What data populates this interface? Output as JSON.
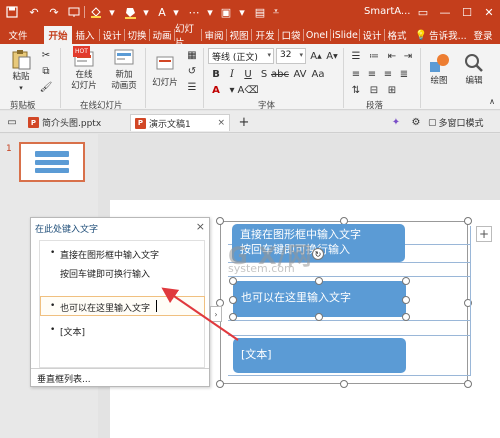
{
  "app": {
    "title": "SmartA...",
    "user_button": "登录",
    "help_search": "告诉我..."
  },
  "ribbon_tabs": [
    "文件",
    "开始",
    "插入",
    "设计",
    "切换",
    "动画",
    "幻灯片",
    "审阅",
    "视图",
    "开发",
    "口袋",
    "OneI",
    "iSlide",
    "设计",
    "格式"
  ],
  "ribbon": {
    "paste": "粘贴",
    "online_slides": "在线\n幻灯片",
    "new_slide": "新加\n动画页",
    "slides_btn": "幻灯片",
    "font_name": "等线 (正文)",
    "font_size": "32",
    "drawing": "绘图",
    "editing": "编辑",
    "group_labels": {
      "clipboard": "剪贴板",
      "online_slides": "在线幻灯片",
      "font": "字体",
      "paragraph": "段落"
    },
    "new_badge": "HOT"
  },
  "doc_tabs": {
    "tab1": "简介头图.pptx",
    "tab2": "演示文稿1",
    "multi_window": "多窗口模式"
  },
  "thumb": {
    "slide_number": "1"
  },
  "text_pane": {
    "title": "在此处键入文字",
    "close": "×",
    "items": [
      "直接在图形框中输入文字",
      "按回车键即可换行输入",
      "也可以在这里输入文字",
      "[文本]"
    ],
    "footer": "垂直框列表..."
  },
  "smartart": {
    "box1_line1": "直接在图形框中输入文字",
    "box1_line2": "按回车键即可换行输入",
    "box2": "也可以在这里输入文字",
    "box3": "[文本]"
  },
  "watermark": {
    "logo": "G X/网",
    "url": "system.com"
  },
  "colors": {
    "accent": "#c43e1c",
    "shape_fill": "#5b9bd5",
    "arrow": "#e0393e"
  }
}
